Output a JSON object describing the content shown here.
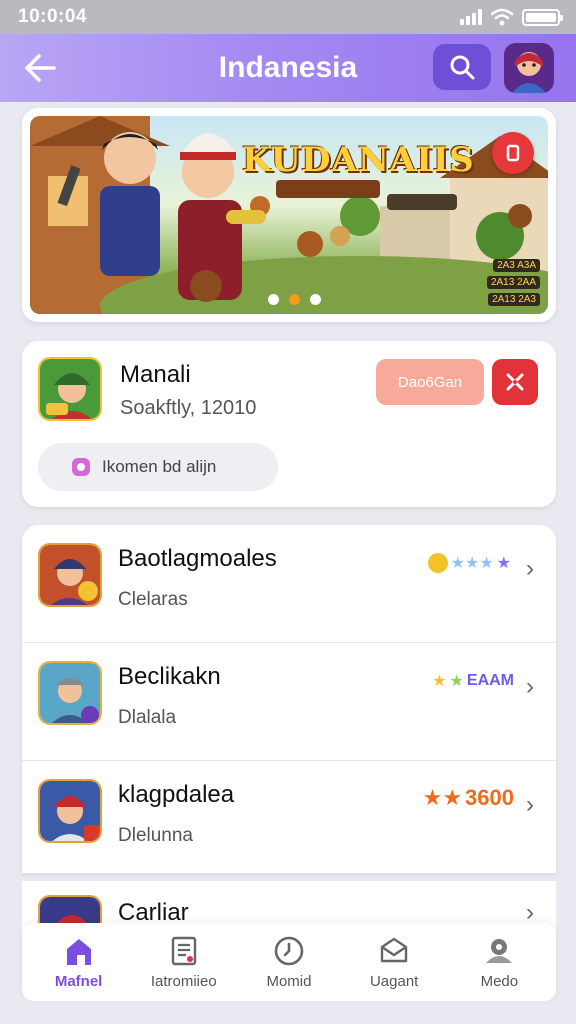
{
  "status_bar": {
    "time": "10:0:04"
  },
  "header": {
    "title": "Indanesia",
    "back_icon": "arrow-left-icon",
    "search_icon": "search-icon"
  },
  "banner": {
    "title": "KUDANAIIS",
    "subtitle_badge": "",
    "pill": "",
    "stats": [
      "2A3 A3A",
      "2A13 2AA",
      "2A13 2A3"
    ],
    "active_dot": 1
  },
  "featured": {
    "name": "Manali",
    "subtitle": "Soakftly, 12010",
    "download_label": "Dao6Gan",
    "chip_label": "Ikomen bd alijn"
  },
  "list": [
    {
      "name": "Baotlagmoales",
      "subtitle": "Clelaras",
      "rating_text": "",
      "rating_color": "#5b7dff"
    },
    {
      "name": "Beclikakn",
      "subtitle": "Dlalala",
      "rating_text": "EAAM",
      "rating_color": "#6a5cf0"
    },
    {
      "name": "klagpdalea",
      "subtitle": "Dlelunna",
      "rating_text": "3600",
      "rating_color": "#f26a1b"
    }
  ],
  "last_row": {
    "name": "Carliar"
  },
  "bottom_nav": [
    {
      "label": "Mafnel",
      "icon": "home-icon",
      "active": true
    },
    {
      "label": "Iatromiieo",
      "icon": "document-icon",
      "active": false
    },
    {
      "label": "Momid",
      "icon": "clock-icon",
      "active": false
    },
    {
      "label": "Uagant",
      "icon": "box-icon",
      "active": false
    },
    {
      "label": "Medo",
      "icon": "profile-icon",
      "active": false
    }
  ],
  "colors": {
    "accent": "#7a4ee0",
    "header_gradient_start": "#b9a6f5",
    "header_gradient_end": "#9574ee",
    "danger": "#e2323a"
  }
}
